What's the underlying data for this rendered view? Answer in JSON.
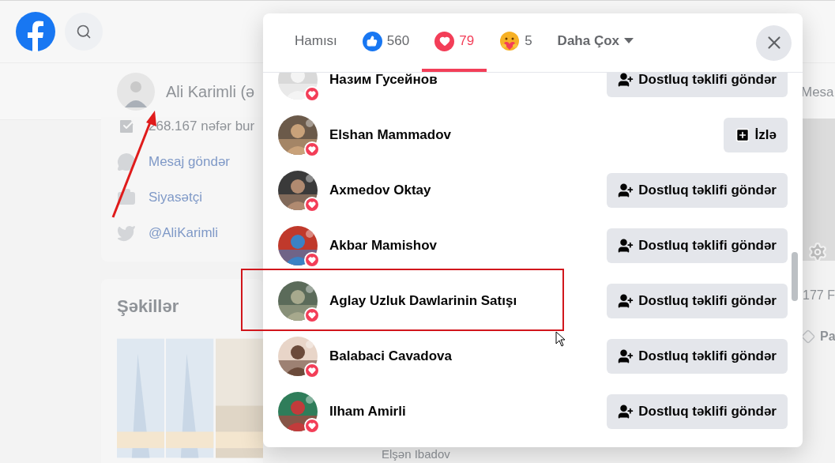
{
  "page": {
    "profile": {
      "name": "Ali Karimli (ə",
      "followers": "268.167 nəfər bur",
      "links": [
        {
          "kind": "messenger",
          "label": "Mesaj göndər"
        },
        {
          "kind": "category",
          "label": "Siyasətçi"
        },
        {
          "kind": "twitter",
          "label": "@AliKarimli"
        }
      ]
    },
    "photos_title": "Şəkillər",
    "right_button": "Mesa",
    "right_count": "177 F",
    "right_item": "Pa",
    "bottom_name": "Elşən Ibadov"
  },
  "dialog": {
    "tabs": [
      {
        "kind": "all",
        "label": "Hamısı",
        "selected": false
      },
      {
        "kind": "like",
        "label": "560",
        "selected": false
      },
      {
        "kind": "love",
        "label": "79",
        "selected": true
      },
      {
        "kind": "care",
        "label": "5",
        "selected": false
      },
      {
        "kind": "more",
        "label": "Daha Çox",
        "selected": false
      }
    ],
    "people": [
      {
        "name": "Назим Гусейнов",
        "button": {
          "kind": "add_friend",
          "label": "Dostluq təklifi göndər"
        }
      },
      {
        "name": "Elshan Mammadov",
        "button": {
          "kind": "follow",
          "label": "İzlə"
        }
      },
      {
        "name": "Axmedov Oktay",
        "button": {
          "kind": "add_friend",
          "label": "Dostluq təklifi göndər"
        }
      },
      {
        "name": "Akbar Mamishov",
        "button": {
          "kind": "add_friend",
          "label": "Dostluq təklifi göndər"
        }
      },
      {
        "name": "Aglay Uzluk Dawlarinin Satışı",
        "button": {
          "kind": "add_friend",
          "label": "Dostluq təklifi göndər"
        }
      },
      {
        "name": "Balabaci Cavadova",
        "button": {
          "kind": "add_friend",
          "label": "Dostluq təklifi göndər"
        }
      },
      {
        "name": "Ilham Amirli",
        "button": {
          "kind": "add_friend",
          "label": "Dostluq təklifi göndər"
        }
      }
    ]
  }
}
